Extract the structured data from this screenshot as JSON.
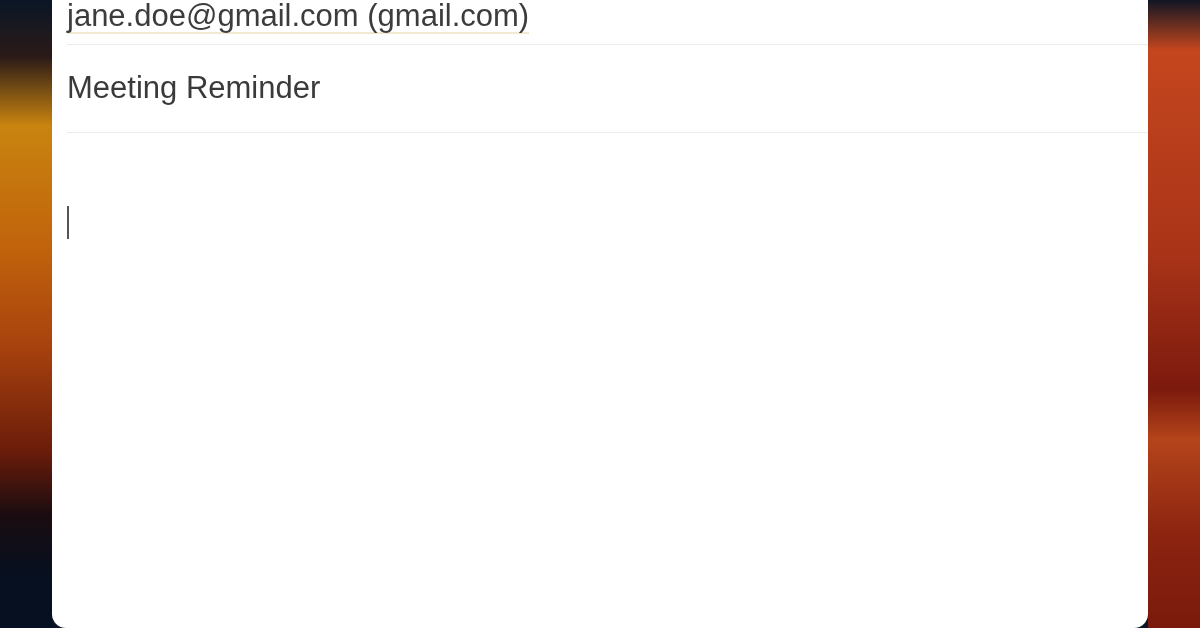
{
  "compose": {
    "from": {
      "value": "jane.doe@gmail.com (gmail.com)"
    },
    "subject": {
      "value": "Meeting Reminder"
    },
    "body": {
      "focused": true
    }
  }
}
